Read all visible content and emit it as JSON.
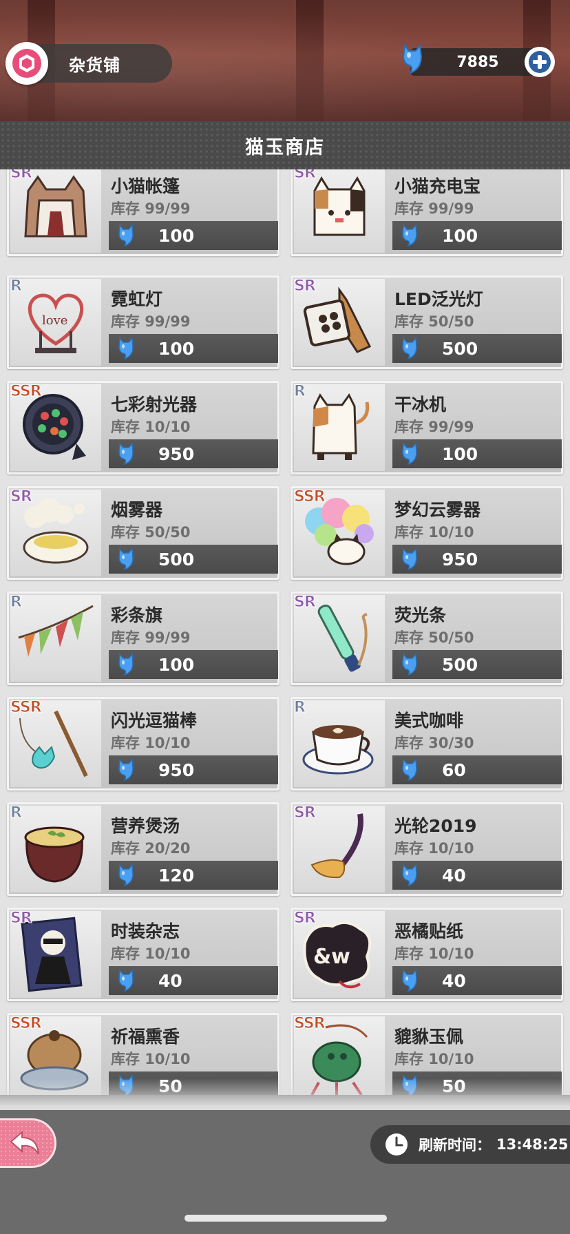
{
  "header": {
    "shop_name": "杂货铺",
    "currency_amount": "7885",
    "title": "猫玉商店"
  },
  "items": [
    {
      "name": "小猫帐篷",
      "stock": "库存 99/99",
      "price": "100",
      "rarity": "SR",
      "icon": "cat-tent-icon"
    },
    {
      "name": "小猫充电宝",
      "stock": "库存 99/99",
      "price": "100",
      "rarity": "SR",
      "icon": "cat-powerbank-icon"
    },
    {
      "name": "霓虹灯",
      "stock": "库存 99/99",
      "price": "100",
      "rarity": "R",
      "icon": "neon-heart-sign-icon"
    },
    {
      "name": "LED泛光灯",
      "stock": "库存 50/50",
      "price": "500",
      "rarity": "SR",
      "icon": "led-floodlight-icon"
    },
    {
      "name": "七彩射光器",
      "stock": "库存 10/10",
      "price": "950",
      "rarity": "SSR",
      "icon": "color-spotlight-icon"
    },
    {
      "name": "干冰机",
      "stock": "库存 99/99",
      "price": "100",
      "rarity": "R",
      "icon": "dry-ice-machine-icon"
    },
    {
      "name": "烟雾器",
      "stock": "库存 50/50",
      "price": "500",
      "rarity": "SR",
      "icon": "smoke-machine-icon"
    },
    {
      "name": "梦幻云雾器",
      "stock": "库存 10/10",
      "price": "950",
      "rarity": "SSR",
      "icon": "rainbow-cloud-machine-icon"
    },
    {
      "name": "彩条旗",
      "stock": "库存 99/99",
      "price": "100",
      "rarity": "R",
      "icon": "bunting-flags-icon"
    },
    {
      "name": "荧光条",
      "stock": "库存 50/50",
      "price": "500",
      "rarity": "SR",
      "icon": "glow-stick-icon"
    },
    {
      "name": "闪光逗猫棒",
      "stock": "库存 10/10",
      "price": "950",
      "rarity": "SSR",
      "icon": "cat-teaser-wand-icon"
    },
    {
      "name": "美式咖啡",
      "stock": "库存 30/30",
      "price": "60",
      "rarity": "R",
      "icon": "coffee-cup-icon"
    },
    {
      "name": "营养煲汤",
      "stock": "库存 20/20",
      "price": "120",
      "rarity": "R",
      "icon": "soup-pot-icon"
    },
    {
      "name": "光轮2019",
      "stock": "库存 10/10",
      "price": "40",
      "rarity": "SR",
      "icon": "broomstick-icon"
    },
    {
      "name": "时装杂志",
      "stock": "库存 10/10",
      "price": "40",
      "rarity": "SR",
      "icon": "fashion-magazine-icon"
    },
    {
      "name": "恶橘贴纸",
      "stock": "库存 10/10",
      "price": "40",
      "rarity": "SR",
      "icon": "sticker-icon"
    },
    {
      "name": "祈福熏香",
      "stock": "库存 10/10",
      "price": "50",
      "rarity": "SSR",
      "icon": "incense-burner-icon"
    },
    {
      "name": "貔貅玉佩",
      "stock": "库存 10/10",
      "price": "50",
      "rarity": "SSR",
      "icon": "jade-pendant-icon"
    }
  ],
  "footer": {
    "refresh_label": "刷新时间：",
    "refresh_time": "13:48:25"
  },
  "colors": {
    "rarity_R": "#6f7f9f",
    "rarity_SR": "#8e5aa8",
    "rarity_SSR": "#c0502a",
    "gem_blue": "#3d8fe0",
    "back_button_pink": "#ea7f97"
  }
}
